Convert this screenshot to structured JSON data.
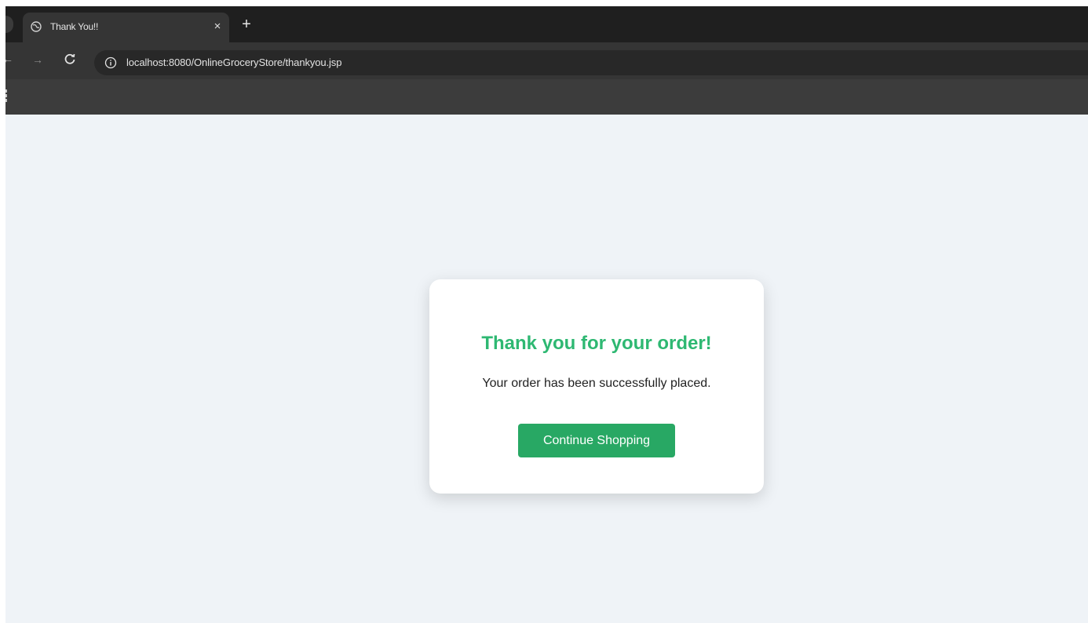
{
  "browser": {
    "tab": {
      "title": "Thank You!!",
      "favicon": "globe-icon"
    },
    "newtab_label": "+",
    "close_label": "×",
    "url": "localhost:8080/OnlineGroceryStore/thankyou.jsp"
  },
  "page": {
    "title": "Thank you for your order!",
    "message": "Your order has been successfully placed.",
    "button_label": "Continue Shopping"
  },
  "colors": {
    "accent_text": "#2eb872",
    "button_bg": "#28a864",
    "page_bg": "#eff3f7"
  }
}
